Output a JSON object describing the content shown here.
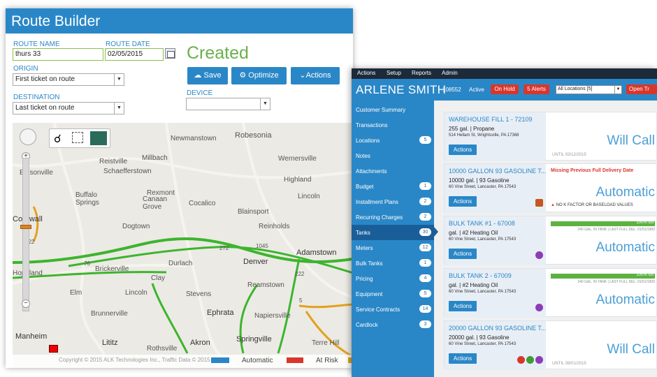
{
  "route_builder": {
    "title": "Route Builder",
    "route_name_label": "ROUTE NAME",
    "route_name_value": "thurs 33",
    "route_date_label": "ROUTE DATE",
    "route_date_value": "02/05/2015",
    "status": "Created",
    "origin_label": "ORIGIN",
    "origin_value": "First ticket on route",
    "destination_label": "DESTINATION",
    "destination_value": "Last ticket on route",
    "device_label": "DEVICE",
    "device_value": "",
    "buttons": {
      "save": "Save",
      "optimize": "Optimize",
      "actions": "Actions"
    },
    "map": {
      "towns": [
        "Robesonia",
        "Newmanstown",
        "Wernersville",
        "Millbach",
        "Reistville",
        "Schaefferstown",
        "Edisonville",
        "Highland",
        "Buffalo Springs",
        "Rexmont",
        "Canaan Grove",
        "Cocalico",
        "Lincoln",
        "Cornwall",
        "Blainsport",
        "Dogtown",
        "Reinholds",
        "Adamstown",
        "1045",
        "Durlach",
        "Denver",
        "Brickerville",
        "Clay",
        "Reamstown",
        "Elm",
        "Lincoln",
        "Stevens",
        "Ephrata",
        "Brunnerville",
        "Napiersville",
        "Manheim",
        "Lititz",
        "Akron",
        "Springville",
        "Rothsville",
        "Terre Hill",
        "Hopeland",
        "5",
        "322",
        "222",
        "76",
        "272"
      ],
      "copyright": "Copyright © 2015 ALK Technologies Inc., Traffic Data © 2015 HERE",
      "legend": [
        {
          "label": "Automatic",
          "color": "#2a87c7"
        },
        {
          "label": "At Risk",
          "color": "#d9362b"
        }
      ]
    }
  },
  "customer": {
    "menu": [
      "Actions",
      "Setup",
      "Reports",
      "Admin"
    ],
    "name": "ARLENE SMITH",
    "account_number": "108552",
    "status": "Active",
    "on_hold": "On Hold",
    "alerts": "5 Alerts",
    "location_select": "All Locations [5]",
    "open_ticket": "Open Tr",
    "sidebar": [
      {
        "label": "Customer Summary",
        "badge": ""
      },
      {
        "label": "Transactions",
        "badge": ""
      },
      {
        "label": "Locations",
        "badge": "5"
      },
      {
        "label": "Notes",
        "badge": ""
      },
      {
        "label": "Attachments",
        "badge": ""
      },
      {
        "label": "Budget",
        "badge": "1"
      },
      {
        "label": "Installment Plans",
        "badge": "2"
      },
      {
        "label": "Recurring Charges",
        "badge": "2"
      },
      {
        "label": "Tanks",
        "badge": "30"
      },
      {
        "label": "Meters",
        "badge": "12"
      },
      {
        "label": "Bulk Tanks",
        "badge": "1"
      },
      {
        "label": "Pricing",
        "badge": "4"
      },
      {
        "label": "Equipment",
        "badge": "5"
      },
      {
        "label": "Service Contracts",
        "badge": "14"
      },
      {
        "label": "Cardlock",
        "badge": "3"
      }
    ],
    "active_index": 8,
    "tanks": [
      {
        "name": "WAREHOUSE FILL 1 - 72109",
        "qty": "255 gal.",
        "product": "Propane",
        "address": "514 Hellam St, Wrightsville, PA 17368",
        "type": "Will Call",
        "until": "UNTIL 03/12/2015",
        "action": "Actions"
      },
      {
        "name": "10000 GALLON 93 GASOLINE T...",
        "qty": "10000 gal.",
        "product": "93 Gasoline",
        "address": "60 Vine Street, Lancaster, PA 17543",
        "type": "Automatic",
        "warning": "Missing Previous Full Delivery Date",
        "warning2": "NO K FACTOR OR BASELOAD VALUES",
        "action": "Actions"
      },
      {
        "name": "BULK TANK #1 - 67008",
        "qty": "gal.",
        "product": "#2 Heating Oil",
        "address": "60 Vine Street, Lancaster, PA 17543",
        "type": "Automatic",
        "gauge_label": "100% full",
        "gauge_pct": 100,
        "gauge_sub": "240 GAL. IN TANK | LAST FULL DEL: 01/01/1900",
        "action": "Actions"
      },
      {
        "name": "BULK TANK 2 - 67009",
        "qty": "gal.",
        "product": "#2 Heating Oil",
        "address": "60 Vine Street, Lancaster, PA 17543",
        "type": "Automatic",
        "gauge_label": "100% full",
        "gauge_pct": 100,
        "gauge_sub": "240 GAL. IN TANK | LAST FULL DEL: 01/01/1900",
        "action": "Actions"
      },
      {
        "name": "20000 GALLON 93 GASOLINE T...",
        "qty": "20000 gal.",
        "product": "93 Gasoline",
        "address": "60 Vine Street, Lancaster, PA 17543",
        "type": "Will Call",
        "until": "UNTIL 08/01/2015",
        "action": "Actions"
      }
    ]
  }
}
